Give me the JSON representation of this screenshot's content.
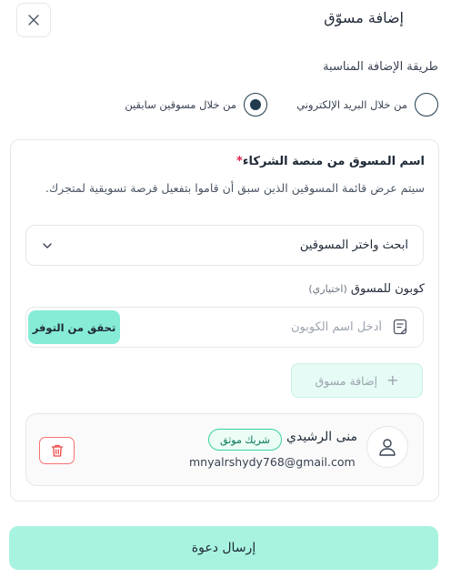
{
  "header": {
    "title": "إضافة مسوّق",
    "close_icon": "close-icon"
  },
  "method": {
    "label": "طريقة الإضافة المناسبة",
    "options": [
      {
        "label": "من خلال البريد الإلكتروني",
        "checked": false
      },
      {
        "label": "من خلال مسوقين سابقين",
        "checked": true
      }
    ]
  },
  "partner_field": {
    "title": "اسم المسوق من منصة الشركاء",
    "required_mark": "*",
    "hint": "سيتم عرض قائمة المسوقين الذين سبق أن قاموا بتفعيل فرصة تسويقية لمتجرك.",
    "select_placeholder": "ابحث واختر المسوقين"
  },
  "coupon": {
    "label": "كوبون للمسوق",
    "optional": "(اختياري)",
    "placeholder": "أدخل اسم الكوبون",
    "check_button": "تحقق من التوفر"
  },
  "add_button": {
    "label": "إضافة مسوق",
    "icon": "plus-icon"
  },
  "marketer": {
    "name": "منى الرشيدي",
    "badge": "شريك موثق",
    "email": "mnyalrshydy768@gmail.com"
  },
  "send_button": "إرسال دعوة",
  "colors": {
    "accent": "#86ecd6",
    "send_bg": "#a7f3df",
    "radio": "#1f3b4d",
    "badge_border": "#34d399",
    "delete": "#ef4444"
  }
}
